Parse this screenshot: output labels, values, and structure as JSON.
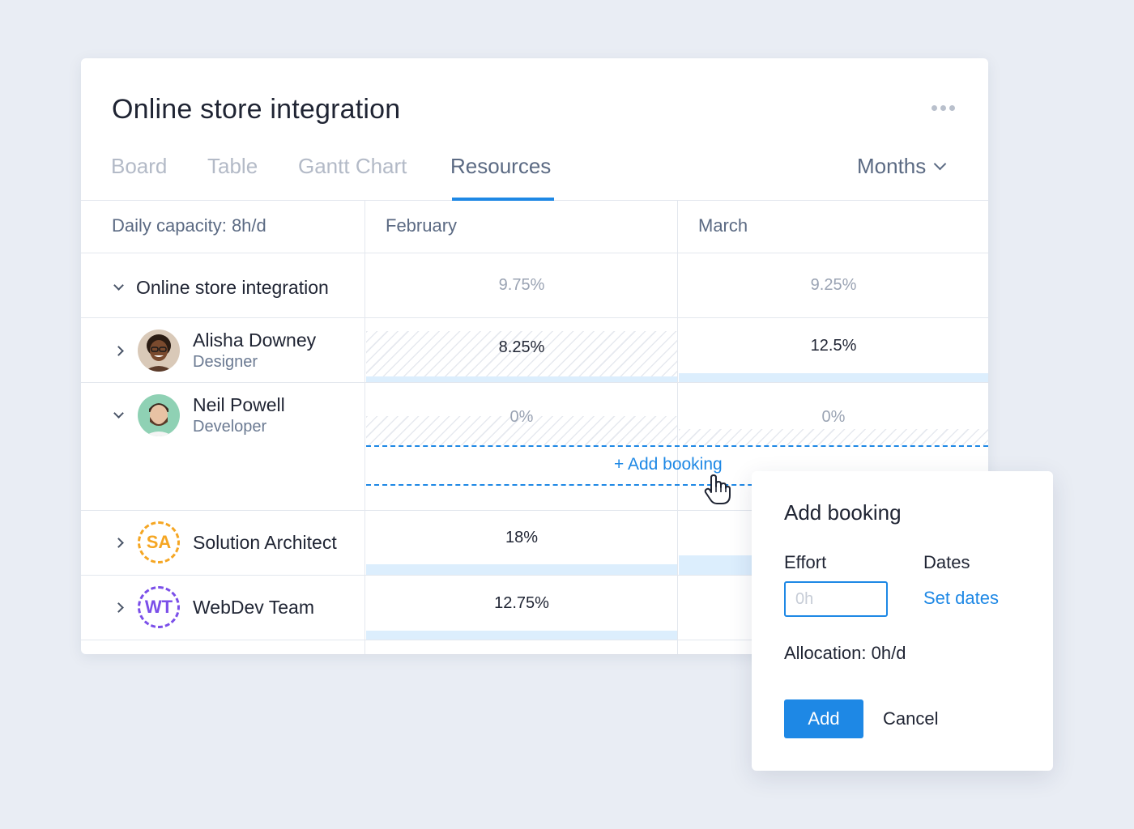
{
  "project": {
    "title": "Online store integration"
  },
  "tabs": [
    {
      "label": "Board"
    },
    {
      "label": "Table"
    },
    {
      "label": "Gantt Chart"
    },
    {
      "label": "Resources",
      "active": true
    }
  ],
  "view_select": {
    "label": "Months"
  },
  "grid": {
    "capacity_label": "Daily capacity: 8h/d",
    "months": [
      "February",
      "March"
    ],
    "project_row": {
      "name": "Online store integration",
      "values": [
        "9.75%",
        "9.25%"
      ]
    },
    "people": [
      {
        "name": "Alisha Downey",
        "role": "Designer",
        "values": [
          "8.25%",
          "12.5%"
        ]
      },
      {
        "name": "Neil Powell",
        "role": "Developer",
        "values": [
          "0%",
          "0%"
        ]
      }
    ],
    "groups": [
      {
        "initials": "SA",
        "name": "Solution Architect",
        "values": [
          "18%"
        ]
      },
      {
        "initials": "WT",
        "name": "WebDev Team",
        "values": [
          "12.75%"
        ]
      }
    ],
    "add_booking_link": "+ Add booking"
  },
  "popover": {
    "title": "Add booking",
    "effort_label": "Effort",
    "effort_placeholder": "0h",
    "dates_label": "Dates",
    "set_dates": "Set dates",
    "allocation": "Allocation: 0h/d",
    "add_button": "Add",
    "cancel_button": "Cancel"
  },
  "colors": {
    "accent": "#1e88e5",
    "sa": "#f5a623",
    "wt": "#7b4fe9"
  },
  "icons": [
    "more-icon",
    "chevron-down-icon",
    "chevron-right-icon",
    "hand-cursor-icon"
  ]
}
